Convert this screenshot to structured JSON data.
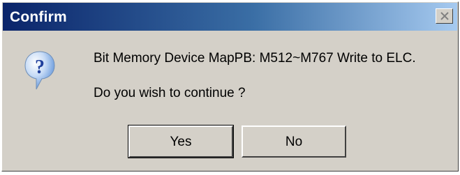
{
  "window": {
    "title": "Confirm",
    "close_icon": "close-icon"
  },
  "message": {
    "icon": "question-icon",
    "line1": "Bit Memory Device MapPB: M512~M767 Write to ELC.",
    "line2": "Do you wish to continue ?"
  },
  "buttons": {
    "yes_label": "Yes",
    "no_label": "No"
  },
  "colors": {
    "titlebar_start": "#0a246a",
    "titlebar_end": "#a6caf0",
    "dialog_face": "#d4d0c8",
    "icon_blue": "#1f5bc4"
  }
}
